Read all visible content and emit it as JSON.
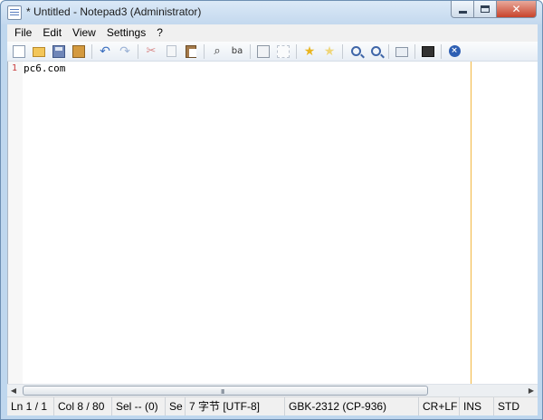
{
  "window": {
    "title": "* Untitled - Notepad3 (Administrator)",
    "controls": {
      "minimize_icon": "minimize-icon",
      "maximize_icon": "maximize-icon",
      "close_glyph": "✕"
    }
  },
  "menubar": {
    "items": [
      {
        "label": "File"
      },
      {
        "label": "Edit"
      },
      {
        "label": "View"
      },
      {
        "label": "Settings"
      },
      {
        "label": "?"
      }
    ]
  },
  "toolbar": {
    "buttons": [
      {
        "icon": "new-file-icon"
      },
      {
        "icon": "open-folder-icon"
      },
      {
        "icon": "save-icon"
      },
      {
        "icon": "save-as-icon"
      },
      {
        "icon": "undo-icon"
      },
      {
        "icon": "redo-icon"
      },
      {
        "icon": "cut-icon"
      },
      {
        "icon": "copy-icon"
      },
      {
        "icon": "paste-icon"
      },
      {
        "icon": "find-binoculars-icon"
      },
      {
        "icon": "replace-icon"
      },
      {
        "icon": "word-wrap-icon"
      },
      {
        "icon": "disabled-tool-icon"
      },
      {
        "icon": "favorites-star-icon"
      },
      {
        "icon": "add-favorite-star-icon"
      },
      {
        "icon": "zoom-in-icon"
      },
      {
        "icon": "zoom-out-icon"
      },
      {
        "icon": "view-scheme-icon"
      },
      {
        "icon": "console-icon"
      },
      {
        "icon": "exit-icon"
      }
    ],
    "glyphs": {
      "undo": "↶",
      "redo": "↷",
      "cut": "✂",
      "find": "⌕",
      "replace": "ba",
      "star": "★",
      "zoom_plus": "+",
      "zoom_minus": "−",
      "exit": "×"
    }
  },
  "editor": {
    "line_number": "1",
    "line_text": "pc6.com",
    "long_line_marker_color": "#f2b740",
    "line_number_color": "#c83b3b"
  },
  "hscroll": {
    "left_arrow": "◀",
    "right_arrow": "▶",
    "grip": "III"
  },
  "statusbar": {
    "ln": "Ln 1 / 1",
    "col": "Col 8 / 80",
    "sel": "Sel -- (0)",
    "se": "Se",
    "bytes_encoding": "7 字节 [UTF-8]",
    "codepage": "GBK-2312 (CP-936)",
    "eol": "CR+LF",
    "ins": "INS",
    "std": "STD"
  },
  "colors": {
    "title_bar": "#c3d8ee",
    "close_button": "#c7432b",
    "accent": "#3b6fbf"
  }
}
